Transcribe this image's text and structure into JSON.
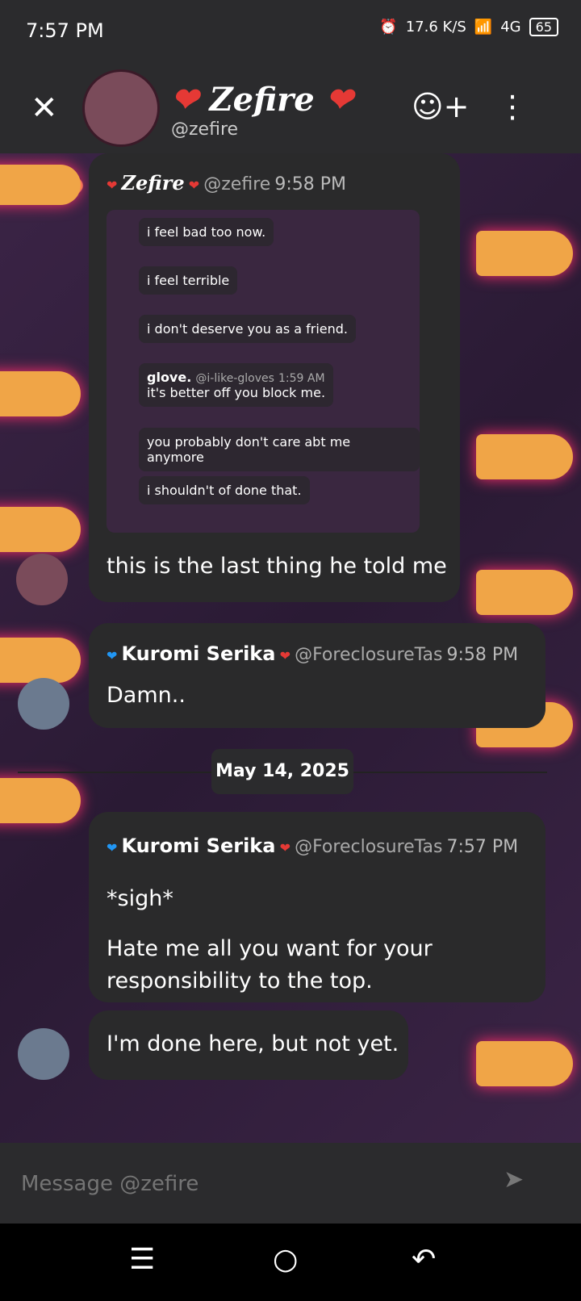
{
  "status": {
    "time": "7:57 PM",
    "net_speed": "17.6 K/S",
    "net": "4G",
    "battery": "65"
  },
  "header": {
    "display_name": "Zefire",
    "username": "@zefire"
  },
  "messages": [
    {
      "author": "Zefire",
      "handle": "@zefire",
      "time": "9:58 PM",
      "text": "this is the last thing he told me",
      "screenshot": [
        "i feel bad too now.",
        "i feel terrible",
        "i don't deserve you as a friend.",
        {
          "author": "glove.",
          "handle": "@i-like-gloves",
          "time": "1:59 AM",
          "text": "it's better off you block me."
        },
        "you probably don't care abt me anymore",
        "i shouldn't of done that."
      ]
    },
    {
      "author": "Kuromi Serika",
      "handle": "@ForeclosureTas",
      "time": "9:58 PM",
      "text": "Damn.."
    },
    {
      "author": "Kuromi Serika",
      "handle": "@ForeclosureTas",
      "time": "7:57 PM",
      "text": [
        "*sigh*",
        "Hate me all you want for your responsibility to the top."
      ]
    },
    {
      "text": "I'm done here, but not yet."
    }
  ],
  "divider": "May 14, 2025",
  "composer": {
    "placeholder": "Message @zefire"
  },
  "colors": {
    "bg": "#2b2b2d",
    "bubble": "#2a2a2b",
    "accent": "#f0a547"
  }
}
